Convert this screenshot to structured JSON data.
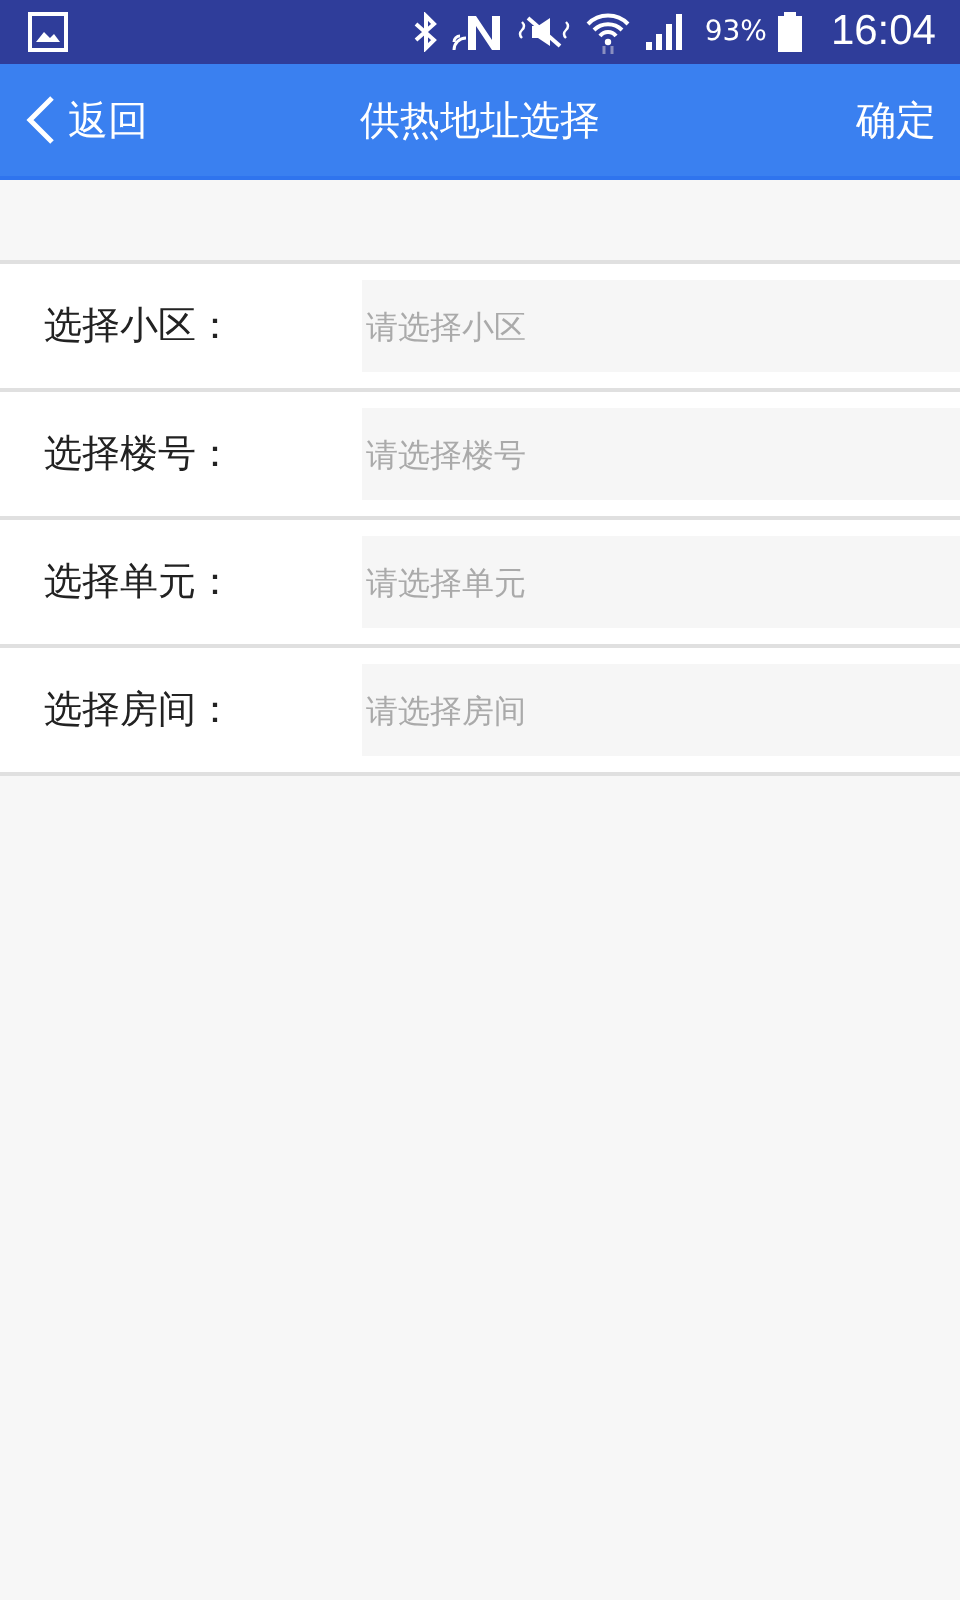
{
  "status_bar": {
    "battery": "93%",
    "time": "16:04"
  },
  "nav": {
    "back": "返回",
    "title": "供热地址选择",
    "confirm": "确定"
  },
  "fields": [
    {
      "label": "选择小区：",
      "placeholder": "请选择小区"
    },
    {
      "label": "选择楼号：",
      "placeholder": "请选择楼号"
    },
    {
      "label": "选择单元：",
      "placeholder": "请选择单元"
    },
    {
      "label": "选择房间：",
      "placeholder": "请选择房间"
    }
  ]
}
